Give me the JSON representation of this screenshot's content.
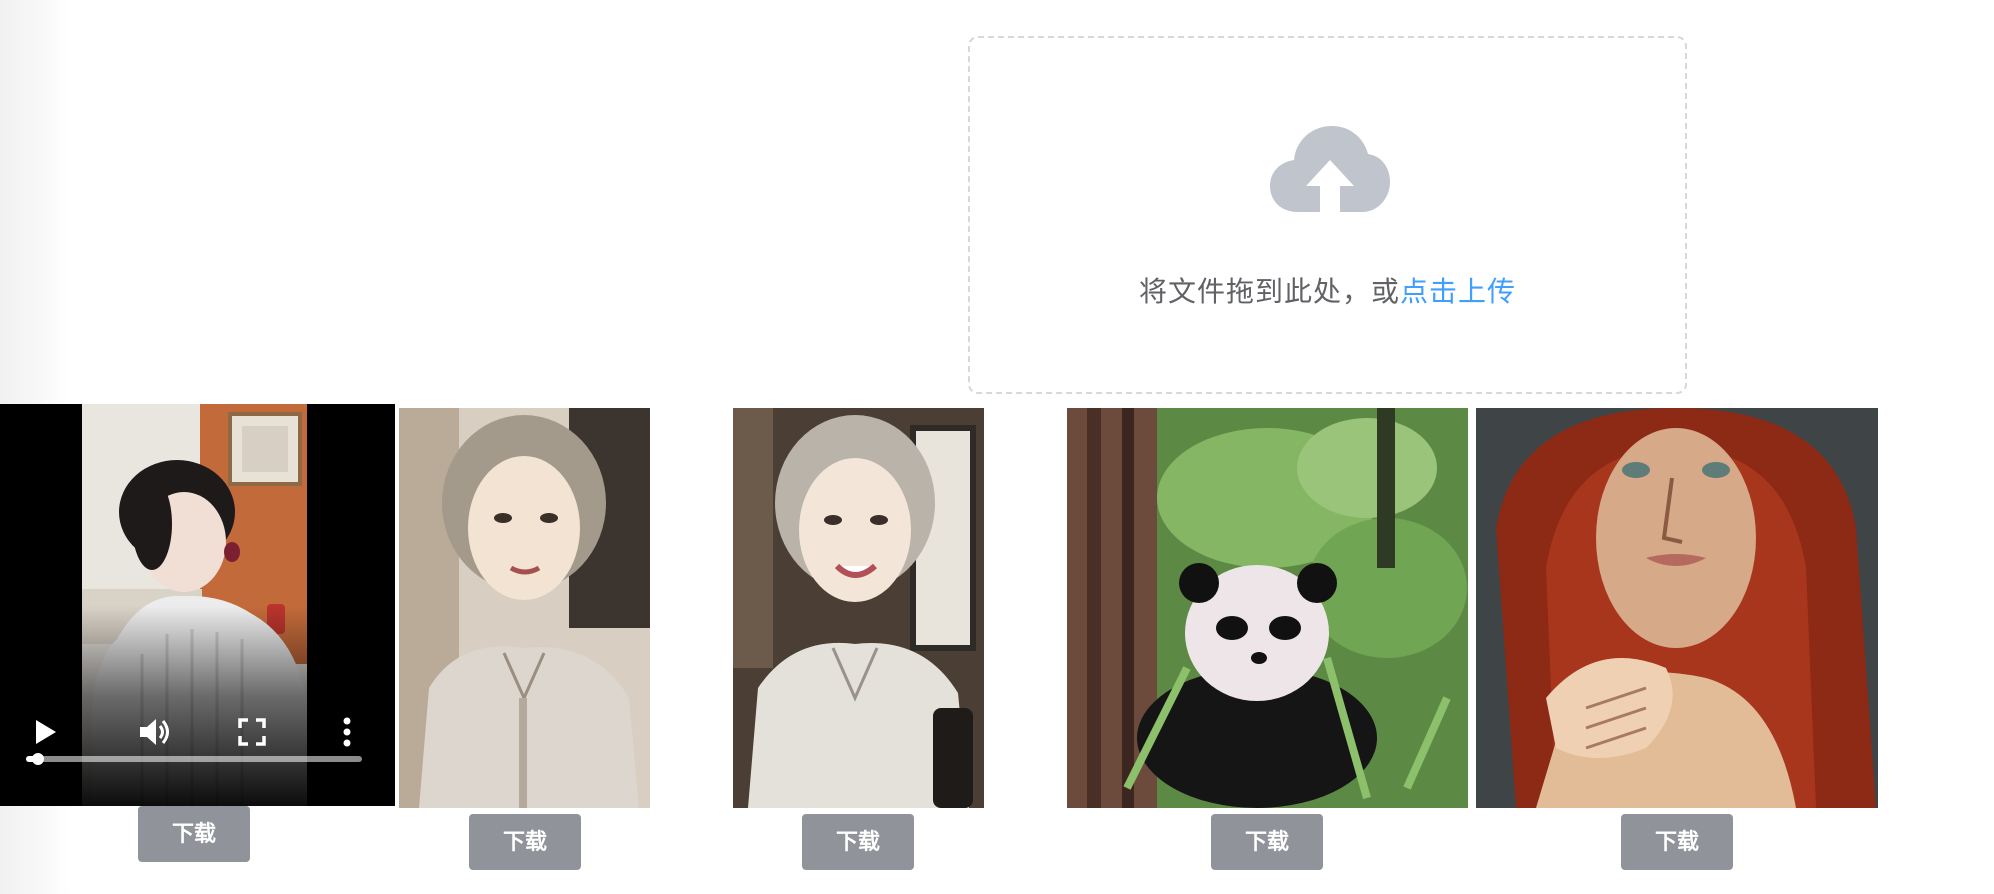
{
  "upload": {
    "hint_text": "将文件拖到此处，或",
    "hint_link": "点击上传",
    "icon": "upload-cloud-icon"
  },
  "video": {
    "icons": [
      "play-icon",
      "volume-icon",
      "fullscreen-icon",
      "more-vertical-icon"
    ],
    "progress": 0.03
  },
  "cards": [
    {
      "kind": "video",
      "download_label": "下载"
    },
    {
      "kind": "image",
      "download_label": "下载"
    },
    {
      "kind": "image",
      "download_label": "下载"
    },
    {
      "kind": "image",
      "download_label": "下载"
    },
    {
      "kind": "image",
      "download_label": "下载"
    }
  ],
  "colors": {
    "link": "#409eff",
    "button_bg": "#909399",
    "dropzone_border": "#d6d8dd",
    "cloud_icon": "#c0c4cc"
  }
}
